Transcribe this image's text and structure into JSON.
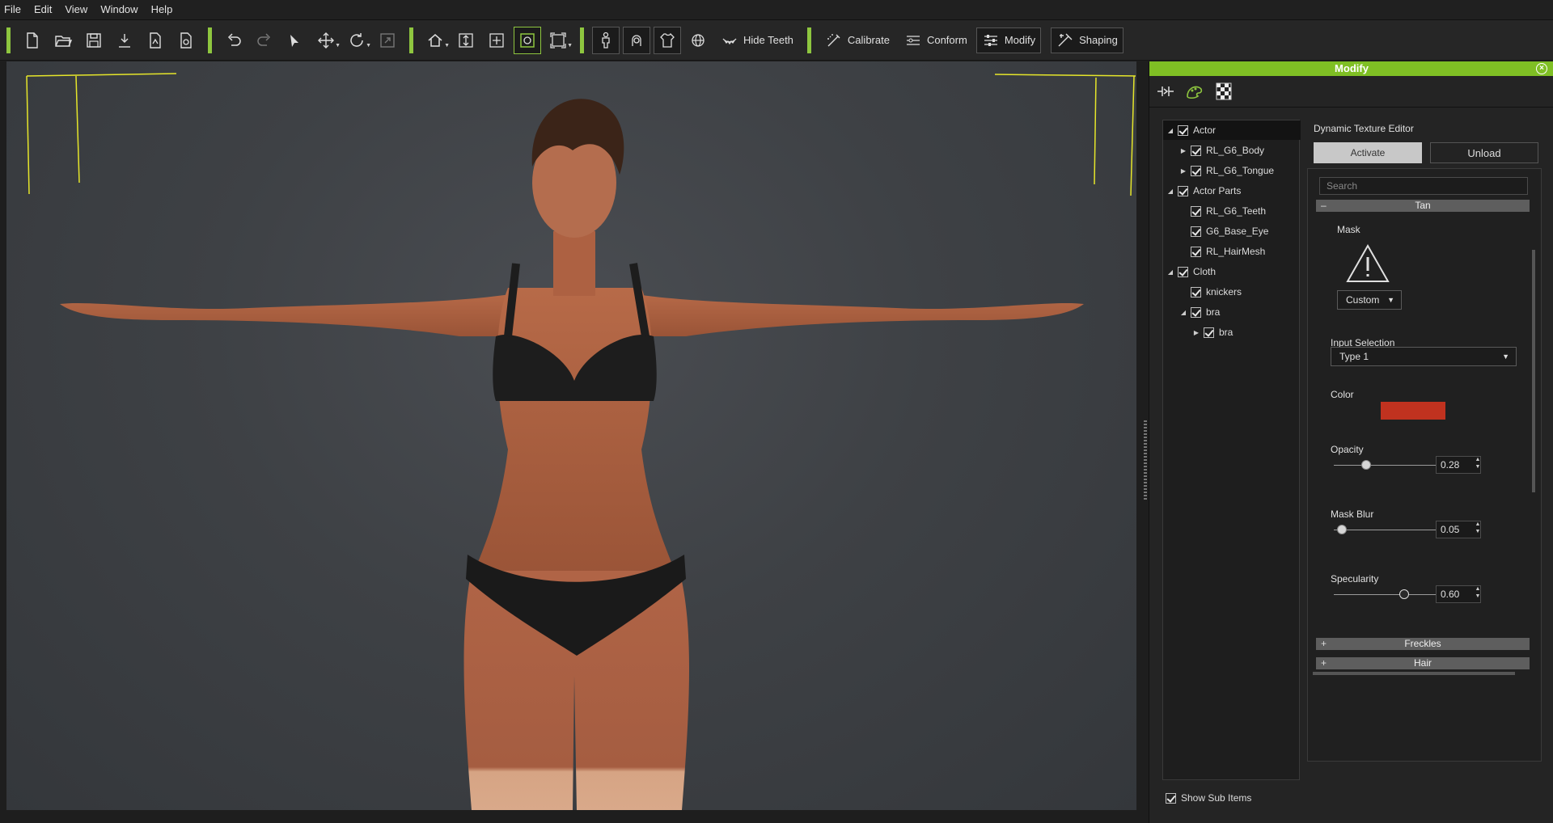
{
  "menu": [
    "File",
    "Edit",
    "View",
    "Window",
    "Help"
  ],
  "toolbar": {
    "hide_teeth": "Hide Teeth",
    "calibrate": "Calibrate",
    "conform": "Conform",
    "modify": "Modify",
    "shaping": "Shaping"
  },
  "colors": {
    "accent_green": "#8ec63f",
    "panel_title_green": "#7fbf24",
    "tan_color": "#c0321f"
  },
  "panel": {
    "title": "Modify",
    "tree": [
      {
        "label": "Actor",
        "expanded": true,
        "checked": true
      },
      {
        "label": "RL_G6_Body",
        "checked": true
      },
      {
        "label": "RL_G6_Tongue",
        "checked": true
      },
      {
        "label": "Actor Parts",
        "expanded": true,
        "checked": true
      },
      {
        "label": "RL_G6_Teeth",
        "checked": true
      },
      {
        "label": "G6_Base_Eye",
        "checked": true
      },
      {
        "label": "RL_HairMesh",
        "checked": true
      },
      {
        "label": "Cloth",
        "expanded": true,
        "checked": true
      },
      {
        "label": "knickers",
        "checked": true
      },
      {
        "label": "bra",
        "expanded": true,
        "checked": true
      },
      {
        "label": "bra",
        "checked": true
      }
    ],
    "show_sub_items": "Show Sub Items",
    "editor": {
      "title": "Dynamic Texture Editor",
      "activate": "Activate",
      "unload": "Unload",
      "search_placeholder": "Search",
      "section_tan": "Tan",
      "mask_label": "Mask",
      "mask_mode": "Custom",
      "input_selection_label": "Input Selection",
      "input_selection_value": "Type 1",
      "color_label": "Color",
      "opacity_label": "Opacity",
      "opacity_value": "0.28",
      "mask_blur_label": "Mask Blur",
      "mask_blur_value": "0.05",
      "specularity_label": "Specularity",
      "specularity_value": "0.60",
      "section_freckles": "Freckles",
      "section_hair": "Hair"
    }
  }
}
